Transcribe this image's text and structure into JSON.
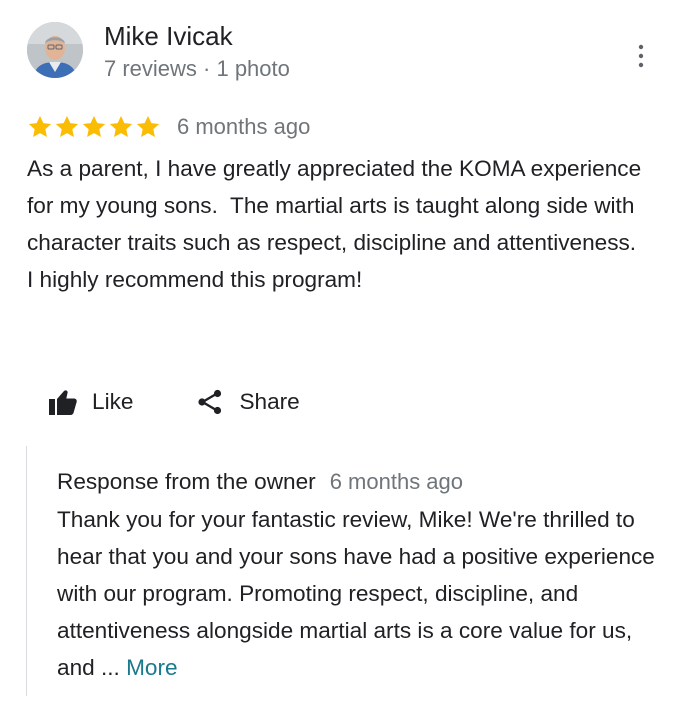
{
  "reviewer": {
    "name": "Mike Ivicak",
    "meta": "7 reviews · 1 photo",
    "avatar_icon": "reviewer-photo"
  },
  "menu_icon": "more-vert-icon",
  "rating": {
    "stars": 5,
    "max_stars": 5,
    "star_color": "#fbbc04",
    "date": "6 months ago"
  },
  "review": {
    "text": "As a parent, I have greatly appreciated the KOMA experience for my young sons.  The martial arts is taught along side with character traits such as respect, discipline and attentiveness.   I highly recommend this program!"
  },
  "actions": {
    "like_label": "Like",
    "like_icon": "thumbs-up-icon",
    "share_label": "Share",
    "share_icon": "share-icon"
  },
  "owner_response": {
    "title": "Response from the owner",
    "date": "6 months ago",
    "text": "Thank you for your fantastic review, Mike! We're thrilled to hear that you and your sons have had a positive experience with our program. Promoting respect, discipline, and attentiveness alongside martial arts is a core value for us, and ...",
    "more_label": "More",
    "more_color": "#1a7a8c"
  }
}
